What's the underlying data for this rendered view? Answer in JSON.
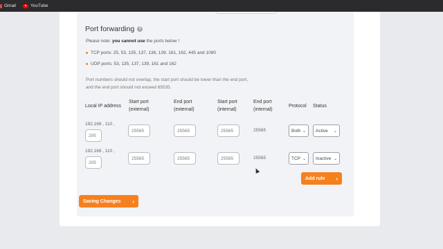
{
  "bookmarks": [
    {
      "label": "Gmail",
      "icon": "gmail-icon"
    },
    {
      "label": "YouTube",
      "icon": "youtube-icon"
    }
  ],
  "section": {
    "title": "Port forwarding",
    "note_prefix": "Please note: ",
    "note_bold": "you cannot use",
    "note_suffix": " the ports below !",
    "tcp_ports": "TCP ports: 25, 53, 135, 137, 138, 139, 161, 162, 445 and 1080",
    "udp_ports": "UDP ports: 53, 135, 137, 139, 161 and 162",
    "info_line1": "Port numbers should not overlap, the start port should be lower than the end port,",
    "info_line2": "and the end port should not exceed 65535."
  },
  "table": {
    "headers": {
      "local_ip": "Local IP address",
      "start_ext_1": "Start port",
      "start_ext_2": "(external)",
      "end_ext_1": "End port",
      "end_ext_2": "(external)",
      "start_int_1": "Start port",
      "start_int_2": "(internal)",
      "end_int_1": "End port",
      "end_int_2": "(internal)",
      "protocol": "Protocol",
      "status": "Status"
    },
    "rows": [
      {
        "ip_prefix": "192,168 , 110 ,",
        "ip_last": "205",
        "start_ext": "25565",
        "end_ext": "25565",
        "start_int": "25565",
        "end_int": "25565",
        "protocol": "Both",
        "status": "Active"
      },
      {
        "ip_prefix": "192,168 , 110 ,",
        "ip_last": "205",
        "start_ext": "25565",
        "end_ext": "25565",
        "start_int": "25565",
        "end_int": "25565",
        "protocol": "TCP",
        "status": "Inactive"
      }
    ]
  },
  "actions": {
    "add_rule": "Add rule",
    "save": "Saving Changes"
  },
  "colors": {
    "accent": "#f7801e",
    "panel": "#f2f3f6",
    "topbar": "#2b2b2d"
  }
}
